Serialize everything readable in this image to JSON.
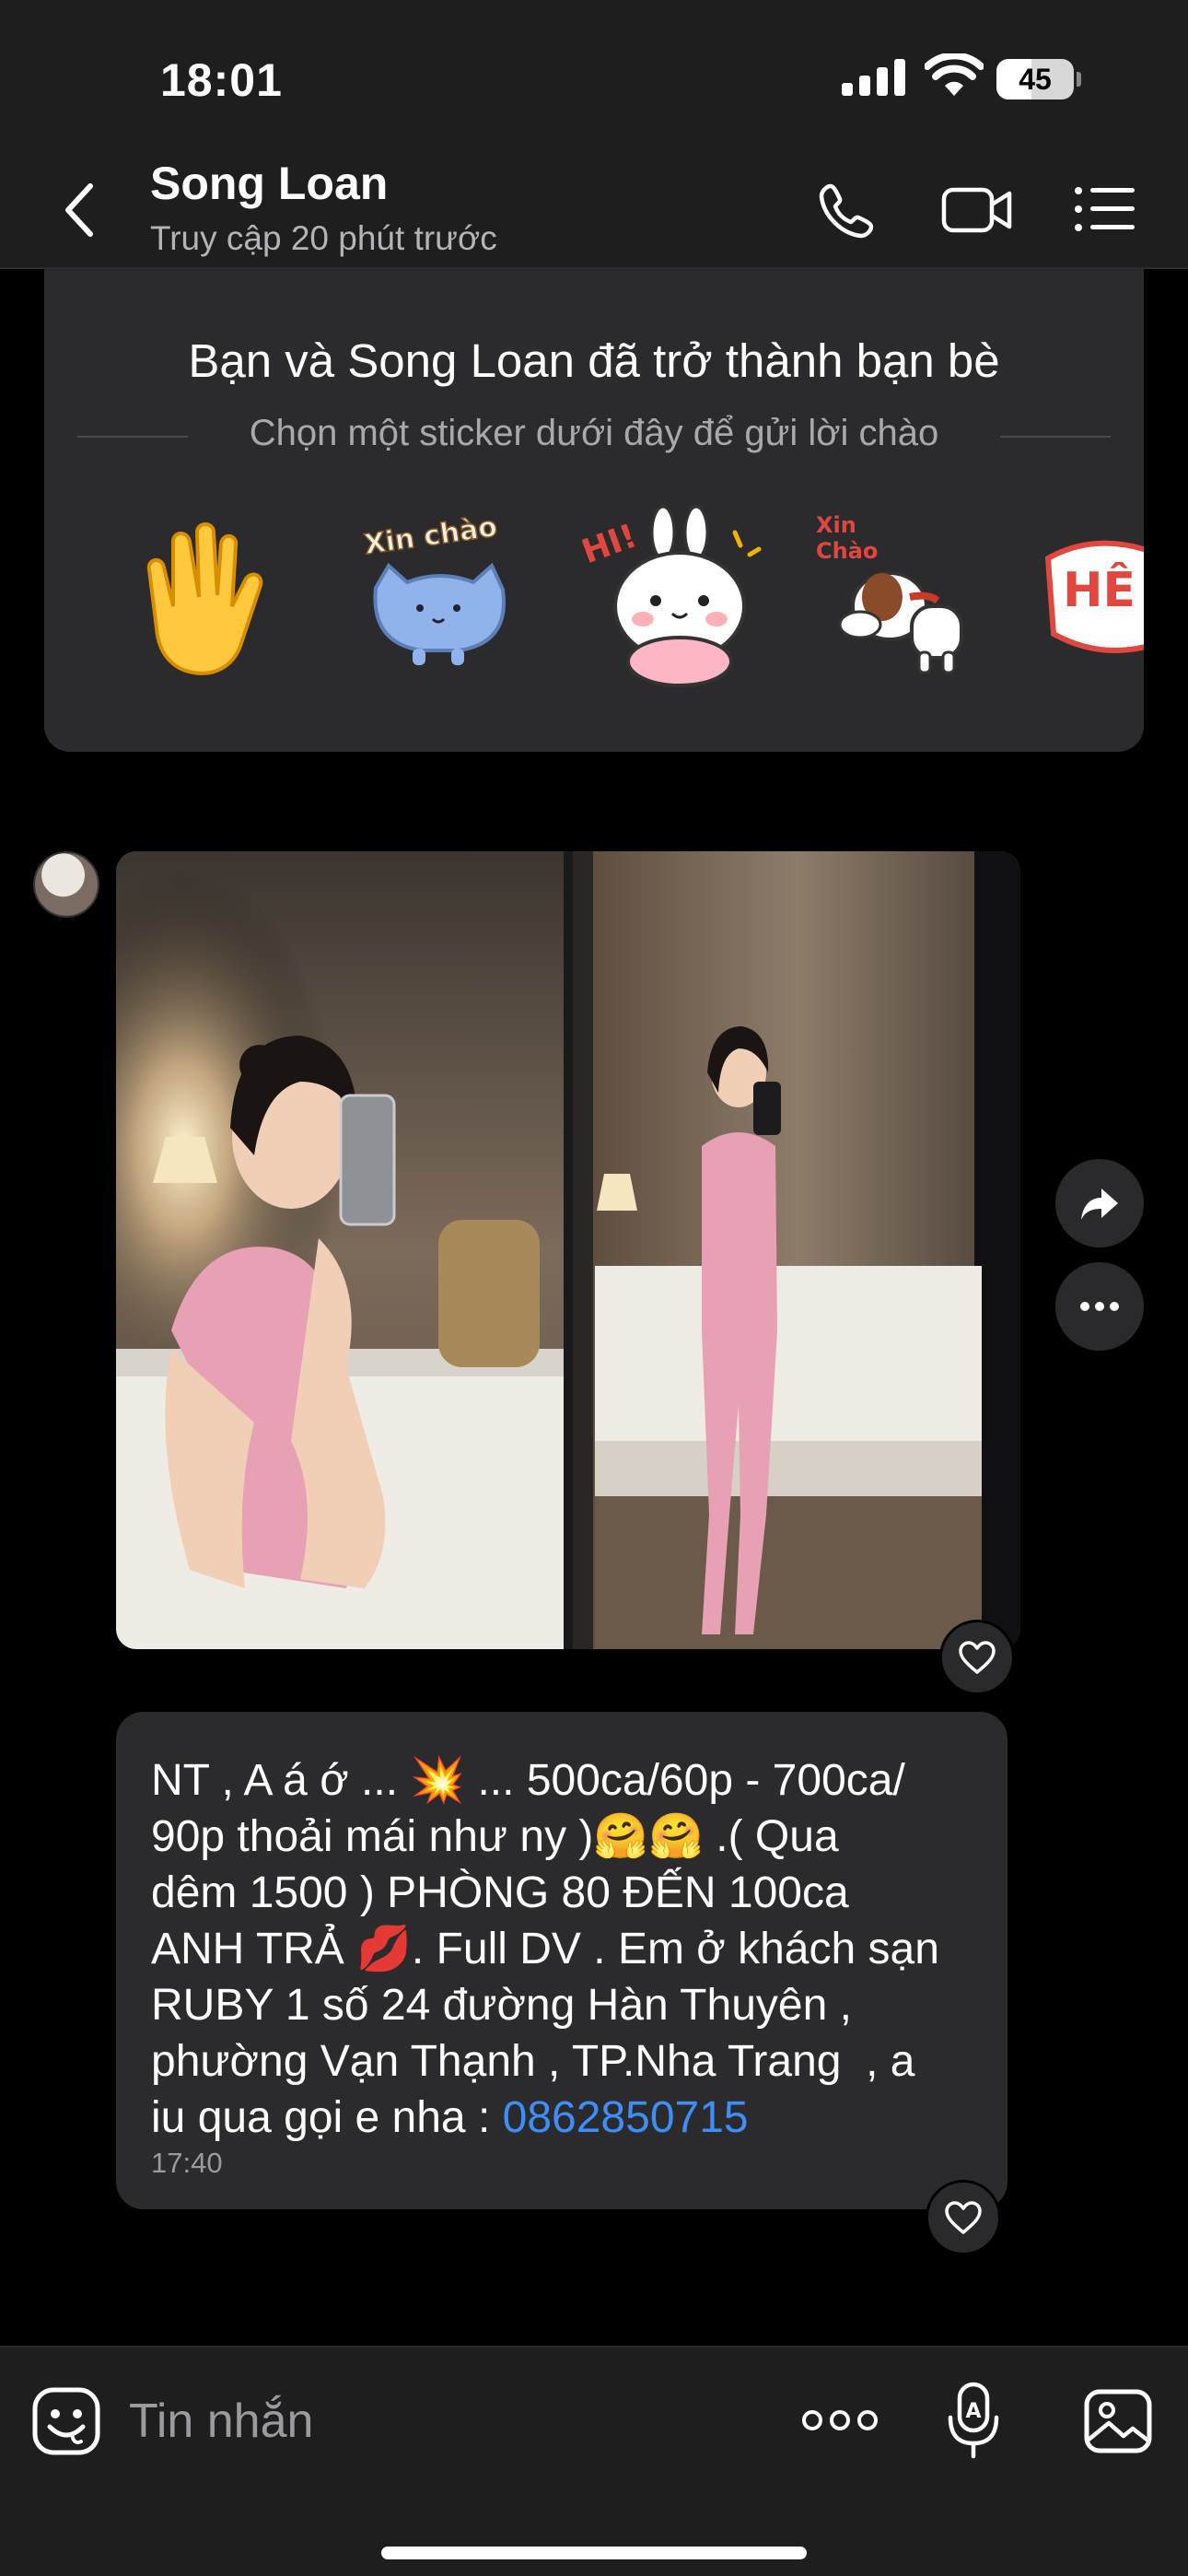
{
  "status_bar": {
    "time": "18:01",
    "battery": "45",
    "battery_level": 0.45
  },
  "header": {
    "contact_name": "Song Loan",
    "contact_status": "Truy cập 20 phút trước"
  },
  "friend_card": {
    "title": "Bạn và Song Loan đã trở thành bạn bè",
    "subtitle": "Chọn một sticker dưới đây để gửi lời chào",
    "stickers": [
      "waving-hand",
      "xin-chao-cat",
      "hi-bunny",
      "xin-chao-dog",
      "hello-sticker"
    ]
  },
  "message": {
    "lines": [
      "NT , A á ớ ... 💥 ... 500ca/60p - 700ca/",
      "90p thoải mái như ny )🤗🤗 .( Qua",
      "dêm 1500 ) PHÒNG 80 ĐẾN 100ca",
      "ANH TRẢ 💋. Full DV . Em ở khách sạn",
      "RUBY 1 số 24 đường Hàn Thuyên ,",
      "phường Vạn Thạnh , TP.Nha Trang  , a",
      "iu qua gọi e nha : "
    ],
    "phone": "0862850715",
    "time": "17:40"
  },
  "input": {
    "placeholder": "Tin nhắn"
  },
  "colors": {
    "bar_bg": "#1e1e1f",
    "bubble_bg": "#2b2b2d",
    "link": "#3d8ef8",
    "muted": "#9a9a9f",
    "pink_outfit": "#e8a0b4"
  }
}
